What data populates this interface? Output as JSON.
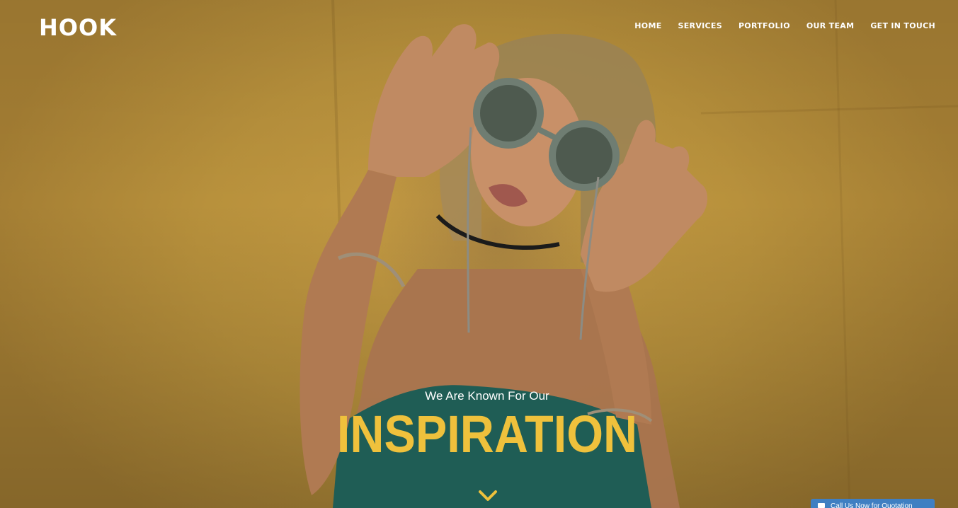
{
  "brand": {
    "logo": "HOOK"
  },
  "nav": {
    "items": [
      "HOME",
      "SERVICES",
      "PORTFOLIO",
      "OUR TEAM",
      "GET IN TOUCH"
    ]
  },
  "hero": {
    "tagline": "We Are Known For Our",
    "headline": "INSPIRATION",
    "scroll_icon": "chevron-down-icon"
  },
  "chat_widget": {
    "label": "Call Us Now for Quotation",
    "icon": "chat-icon"
  },
  "colors": {
    "background": "#b8913c",
    "headline": "#efc13c",
    "text": "#ffffff",
    "chat_tab": "#3f7fc2"
  }
}
